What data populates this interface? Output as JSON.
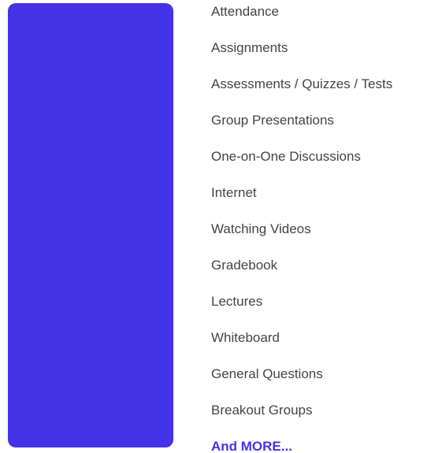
{
  "colors": {
    "panel": "#4433e6",
    "text": "#444444",
    "accent": "#4433e6"
  },
  "features": [
    {
      "label": "Attendance"
    },
    {
      "label": "Assignments"
    },
    {
      "label": "Assessments / Quizzes / Tests"
    },
    {
      "label": "Group Presentations"
    },
    {
      "label": "One-on-One Discussions"
    },
    {
      "label": "Internet"
    },
    {
      "label": "Watching Videos"
    },
    {
      "label": "Gradebook"
    },
    {
      "label": "Lectures"
    },
    {
      "label": "Whiteboard"
    },
    {
      "label": "General Questions"
    },
    {
      "label": "Breakout Groups"
    }
  ],
  "more_link": "And MORE..."
}
